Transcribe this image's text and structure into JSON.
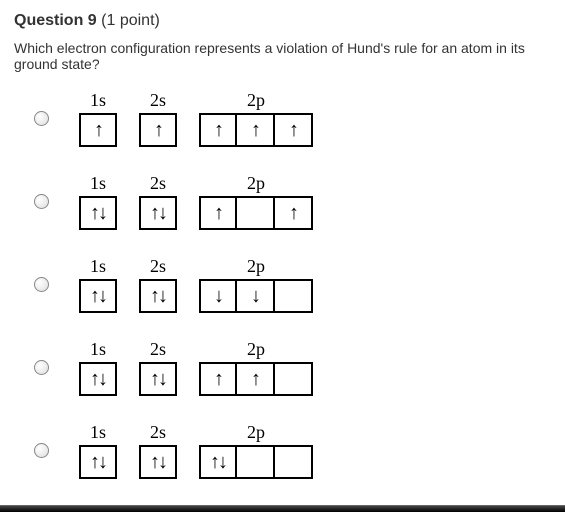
{
  "question": {
    "number_label": "Question 9",
    "points_label": "(1 point)",
    "prompt": "Which electron configuration represents a violation of Hund's rule for an atom in its ground state?"
  },
  "labels": {
    "s1": "1s",
    "s2": "2s",
    "p2": "2p"
  },
  "arrows": {
    "up": "↑",
    "down": "↓",
    "updown": "↑↓",
    "downdown": "",
    "empty": ""
  },
  "options": [
    {
      "s1": "up",
      "s2": "up",
      "p": [
        "up",
        "up",
        "up"
      ]
    },
    {
      "s1": "updown",
      "s2": "updown",
      "p": [
        "up",
        "empty",
        "up"
      ]
    },
    {
      "s1": "updown",
      "s2": "updown",
      "p": [
        "down",
        "down",
        "empty"
      ]
    },
    {
      "s1": "updown",
      "s2": "updown",
      "p": [
        "up",
        "up",
        "empty"
      ]
    },
    {
      "s1": "updown",
      "s2": "updown",
      "p": [
        "updown",
        "empty",
        "empty"
      ]
    }
  ]
}
